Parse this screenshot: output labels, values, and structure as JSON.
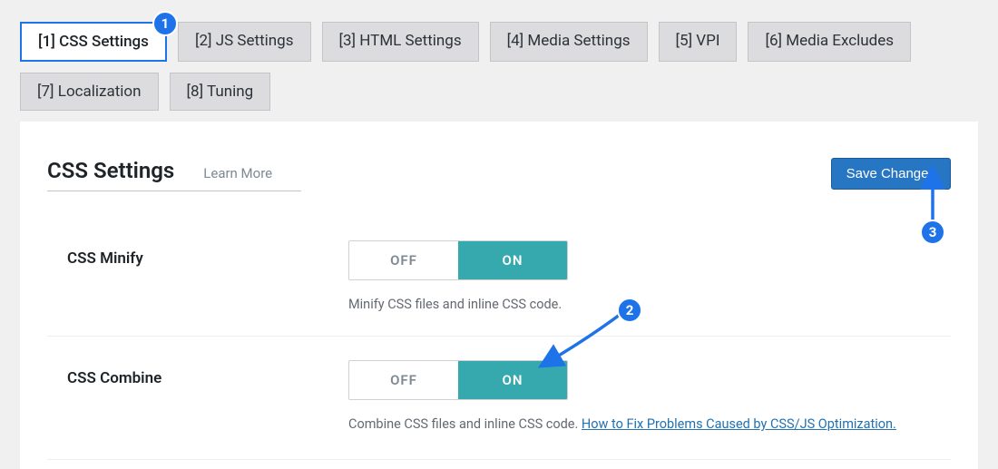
{
  "tabs": {
    "row": [
      {
        "label": "[1] CSS Settings",
        "active": true
      },
      {
        "label": "[2] JS Settings"
      },
      {
        "label": "[3] HTML Settings"
      },
      {
        "label": "[4] Media Settings"
      },
      {
        "label": "[5] VPI"
      },
      {
        "label": "[6] Media Excludes"
      },
      {
        "label": "[7] Localization"
      },
      {
        "label": "[8] Tuning"
      }
    ]
  },
  "header": {
    "title": "CSS Settings",
    "learn_more": "Learn More",
    "save_button": "Save Changes"
  },
  "fields": {
    "css_minify": {
      "label": "CSS Minify",
      "off": "OFF",
      "on": "ON",
      "desc": "Minify CSS files and inline CSS code."
    },
    "css_combine": {
      "label": "CSS Combine",
      "off": "OFF",
      "on": "ON",
      "desc_prefix": "Combine CSS files and inline CSS code. ",
      "desc_link": "How to Fix Problems Caused by CSS/JS Optimization."
    }
  },
  "annotations": {
    "b1": "1",
    "b2": "2",
    "b3": "3"
  },
  "colors": {
    "accent": "#1e73e8",
    "toggle_on": "#36A9AE",
    "save_btn": "#2776c4"
  }
}
